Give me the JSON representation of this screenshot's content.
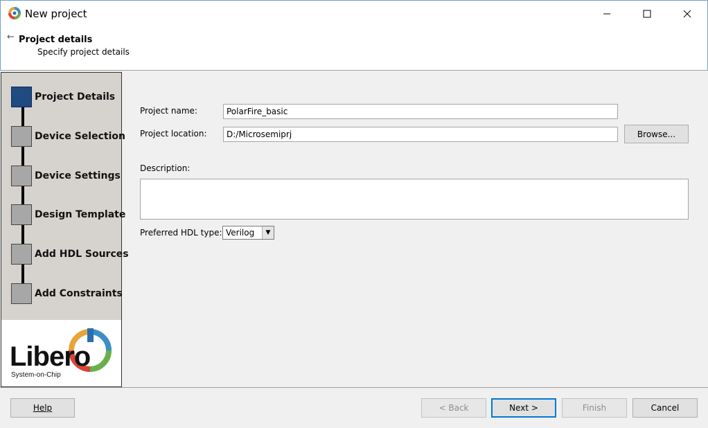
{
  "window": {
    "title": "New project",
    "icons": {
      "app": "libero-app-icon",
      "minimize": "minimize-icon",
      "maximize": "maximize-icon",
      "close": "close-icon"
    }
  },
  "header": {
    "back_icon": "back-arrow-icon",
    "title": "Project details",
    "subtitle": "Specify project details"
  },
  "steps": [
    {
      "label": "Project Details",
      "active": true
    },
    {
      "label": "Device Selection",
      "active": false
    },
    {
      "label": "Device Settings",
      "active": false
    },
    {
      "label": "Design Template",
      "active": false
    },
    {
      "label": "Add HDL Sources",
      "active": false
    },
    {
      "label": "Add Constraints",
      "active": false
    }
  ],
  "logo": {
    "name": "Libero",
    "tagline": "System-on-Chip"
  },
  "form": {
    "project_name_label": "Project name:",
    "project_name_value": "PolarFire_basic",
    "project_location_label": "Project location:",
    "project_location_value": "D:/Microsemiprj",
    "browse_label": "Browse...",
    "description_label": "Description:",
    "description_value": "",
    "hdl_label": "Preferred HDL type:",
    "hdl_value": "Verilog"
  },
  "footer": {
    "help_label": "Help",
    "back_label": "< Back",
    "next_label": "Next >",
    "finish_label": "Finish",
    "cancel_label": "Cancel"
  },
  "colors": {
    "active_step": "#1f4a82",
    "inactive_step": "#a7a7a7",
    "steps_panel": "#d6d3ce",
    "default_button_border": "#0078d7"
  }
}
